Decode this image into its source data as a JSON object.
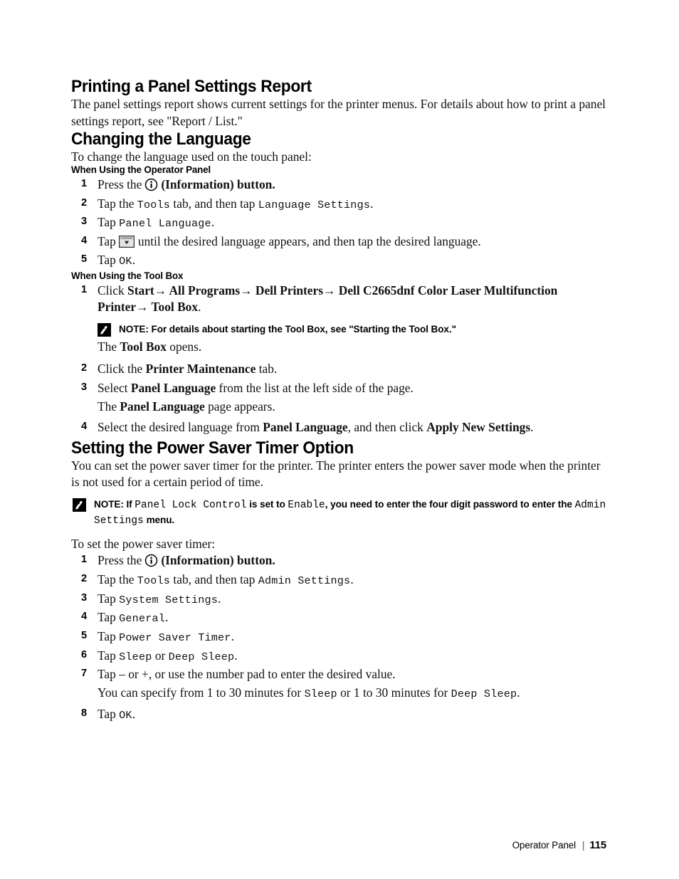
{
  "doc": {
    "footer": {
      "chapter": "Operator Panel",
      "separator": "|",
      "page": "115"
    }
  },
  "sections": {
    "panel_report": {
      "title": "Printing a Panel Settings Report",
      "intro": "The panel settings report shows current settings for the printer menus. For details about how to print a panel settings report, see \"Report / List.\""
    },
    "changing_language": {
      "title": "Changing the Language",
      "intro": "To change the language used on the touch panel:",
      "operator_panel": {
        "heading": "When Using the Operator Panel",
        "steps": {
          "s1": {
            "num": "1",
            "pre": "Press the",
            "post": "(Information) button."
          },
          "s2": {
            "num": "2",
            "a": "Tap the ",
            "code1": "Tools",
            "b": " tab, and then tap ",
            "code2": "Language Settings",
            "c": "."
          },
          "s3": {
            "num": "3",
            "a": "Tap ",
            "code1": "Panel Language",
            "b": "."
          },
          "s4": {
            "num": "4",
            "pre": "Tap",
            "post": "until the desired language appears, and then tap the desired language."
          },
          "s5": {
            "num": "5",
            "a": "Tap ",
            "code1": "OK",
            "b": "."
          }
        }
      },
      "tool_box": {
        "heading": "When Using the Tool Box",
        "steps": {
          "s1": {
            "num": "1",
            "click": "Click ",
            "start": "Start",
            "arrow1": "→",
            "all_programs": " All Programs",
            "arrow2": "→",
            "dell_printers": " Dell Printers",
            "arrow3": "→",
            "printer_model": " Dell C2665dnf Color Laser Multifunction Printer",
            "arrow4": "→",
            "tool_box": " Tool Box",
            "period": ".",
            "note_label": "NOTE:",
            "note_text": "For details about starting the Tool Box, see \"Starting the Tool Box.\"",
            "result_a": "The ",
            "result_b": "Tool Box",
            "result_c": " opens."
          },
          "s2": {
            "num": "2",
            "a": "Click the ",
            "b": "Printer Maintenance",
            "c": " tab."
          },
          "s3": {
            "num": "3",
            "a": "Select ",
            "b": "Panel Language",
            "c": " from the list at the left side of the page.",
            "sub_a": "The ",
            "sub_b": "Panel Language",
            "sub_c": " page appears."
          },
          "s4": {
            "num": "4",
            "a": "Select the desired language from ",
            "b": "Panel Language",
            "c": ", and then click ",
            "d": "Apply New Settings",
            "e": "."
          }
        }
      }
    },
    "power_saver": {
      "title": "Setting the Power Saver Timer Option",
      "intro": "You can set the power saver timer for the printer. The printer enters the power saver mode when the printer is not used for a certain period of time.",
      "note": {
        "label": "NOTE:",
        "a": "If ",
        "code1": "Panel Lock Control",
        "b": " is set to ",
        "code2": "Enable",
        "c": ", you need to enter the four digit password to enter the ",
        "code3": "Admin Settings",
        "d": " menu."
      },
      "lead": "To set the power saver timer:",
      "steps": {
        "s1": {
          "num": "1",
          "pre": "Press the",
          "post": "(Information) button."
        },
        "s2": {
          "num": "2",
          "a": "Tap the ",
          "code1": "Tools",
          "b": " tab, and then tap ",
          "code2": "Admin Settings",
          "c": "."
        },
        "s3": {
          "num": "3",
          "a": "Tap ",
          "code1": "System Settings",
          "b": "."
        },
        "s4": {
          "num": "4",
          "a": "Tap ",
          "code1": "General",
          "b": "."
        },
        "s5": {
          "num": "5",
          "a": "Tap ",
          "code1": "Power Saver Timer",
          "b": "."
        },
        "s6": {
          "num": "6",
          "a": "Tap ",
          "code1": "Sleep",
          "b": " or ",
          "code2": "Deep Sleep",
          "c": "."
        },
        "s7": {
          "num": "7",
          "a": "Tap – or +, or use the number pad to enter the desired value.",
          "sub_a": "You can specify from 1 to 30 minutes for ",
          "sub_code1": "Sleep",
          "sub_b": " or 1 to 30 minutes for ",
          "sub_code2": "Deep Sleep",
          "sub_c": "."
        },
        "s8": {
          "num": "8",
          "a": "Tap ",
          "code1": "OK",
          "b": "."
        }
      }
    }
  },
  "icons": {
    "information": "information-icon",
    "dropdown": "dropdown-arrow-button",
    "note": "note-pencil-icon"
  }
}
